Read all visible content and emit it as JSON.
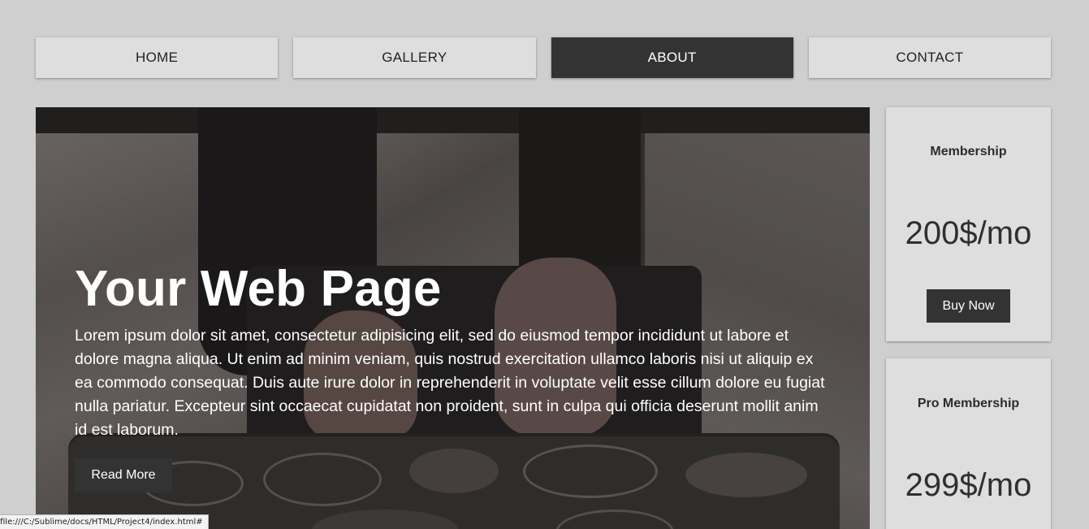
{
  "nav": {
    "items": [
      {
        "label": "HOME",
        "active": false
      },
      {
        "label": "GALLERY",
        "active": false
      },
      {
        "label": "ABOUT",
        "active": true
      },
      {
        "label": "CONTACT",
        "active": false
      }
    ]
  },
  "hero": {
    "title": "Your Web Page",
    "text": "Lorem ipsum dolor sit amet, consectetur adipisicing elit, sed do eiusmod tempor incididunt ut labore et dolore magna aliqua. Ut enim ad minim veniam, quis nostrud exercitation ullamco laboris nisi ut aliquip ex ea commodo consequat. Duis aute irure dolor in reprehenderit in voluptate velit esse cillum dolore eu fugiat nulla pariatur. Excepteur sint occaecat cupidatat non proident, sunt in culpa qui officia deserunt mollit anim id est laborum.",
    "button_label": "Read More"
  },
  "cards": [
    {
      "title": "Membership",
      "price": "200$/mo",
      "button_label": "Buy Now"
    },
    {
      "title": "Pro Membership",
      "price": "299$/mo"
    }
  ],
  "status_bar": {
    "url": "file:///C:/Sublime/docs/HTML/Project4/index.html#"
  },
  "colors": {
    "page_background": "#cfcfcf",
    "nav_background": "#dedede",
    "active_background": "#333333",
    "button_background": "#333333",
    "text_light": "#ffffff"
  }
}
